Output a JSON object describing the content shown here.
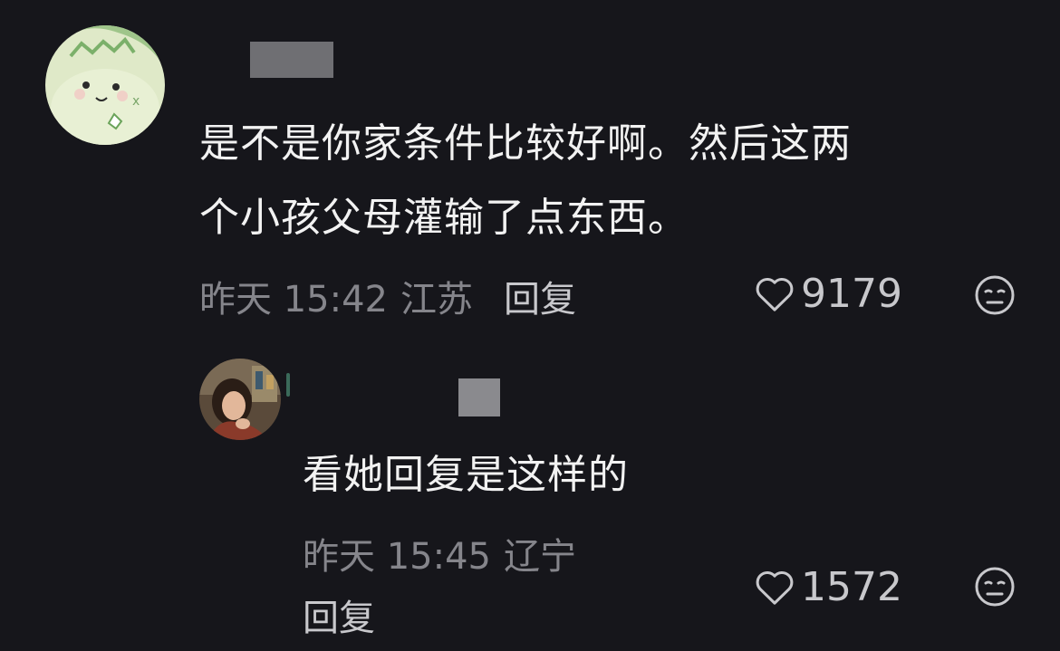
{
  "comments": [
    {
      "avatar_icon": "green-cartoon-avatar",
      "text_lines": [
        "是不是你家条件比较好啊。然后这两",
        "个小孩父母灌输了点东西。"
      ],
      "time": "昨天 15:42",
      "location": "江苏",
      "reply_label": "回复",
      "likes": "9179",
      "reaction_icon": "meh-face-icon"
    },
    {
      "avatar_icon": "photo-avatar",
      "text_lines": [
        "看她回复是这样的"
      ],
      "time": "昨天 15:45",
      "location": "辽宁",
      "reply_label": "回复",
      "likes": "1572",
      "reaction_icon": "meh-face-icon"
    }
  ],
  "colors": {
    "background": "#16161b",
    "text": "#f2f2f2",
    "meta": "#85858b",
    "reply": "#c8c8cc"
  }
}
